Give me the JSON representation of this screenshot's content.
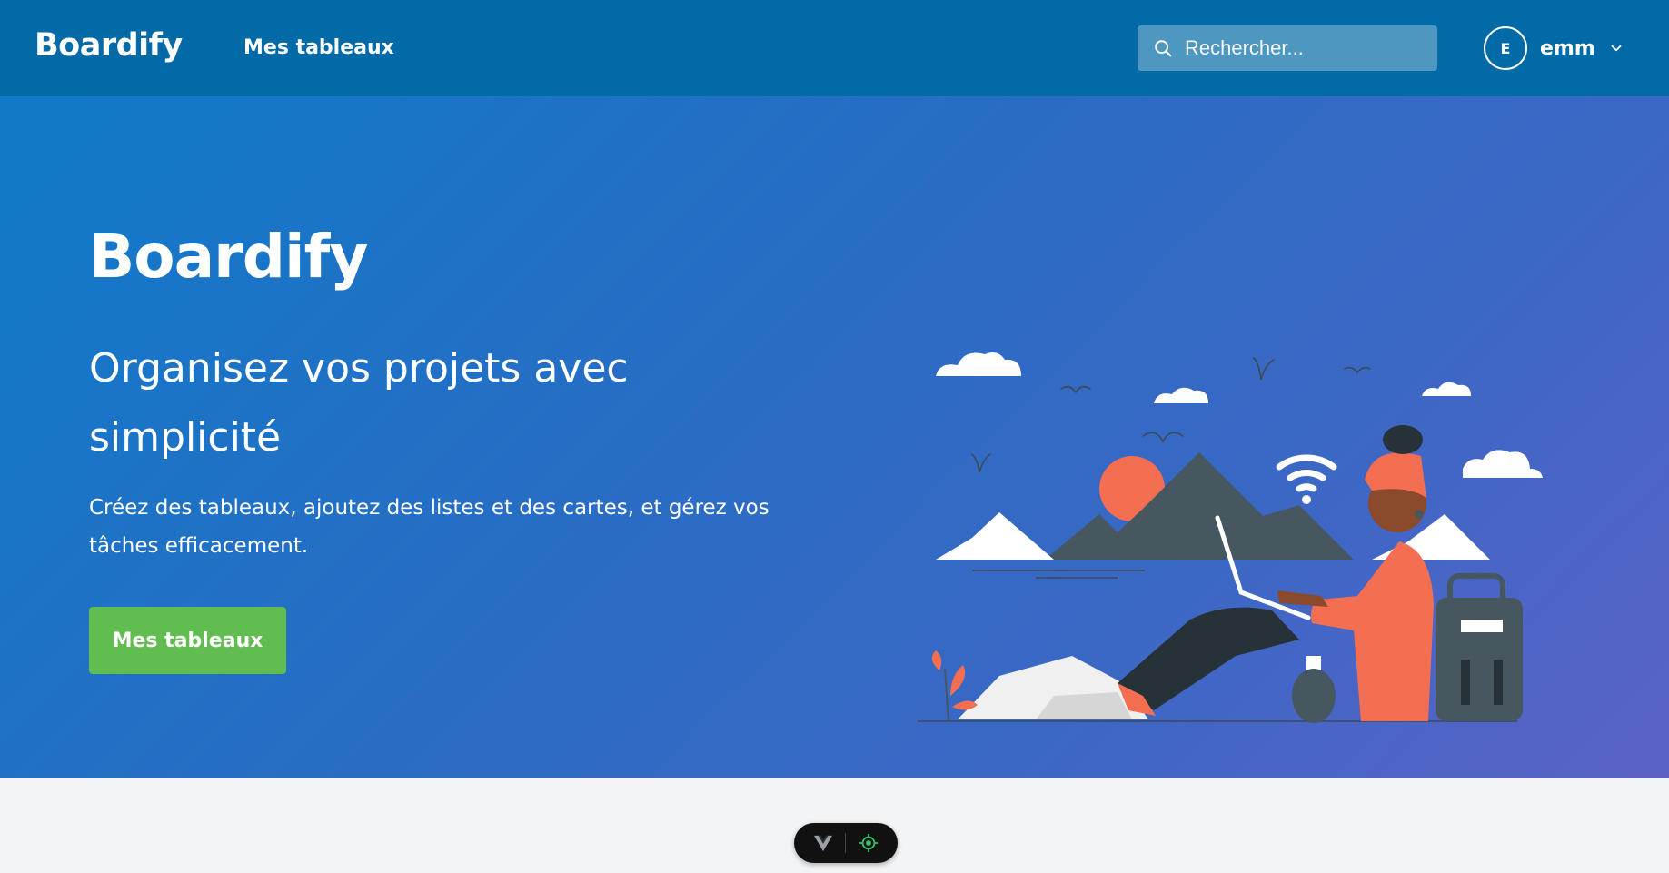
{
  "navbar": {
    "brand": "Boardify",
    "link_label": "Mes tableaux",
    "search_placeholder": "Rechercher...",
    "user": {
      "initial": "E",
      "name": "emm"
    }
  },
  "hero": {
    "title": "Boardify",
    "subtitle": "Organisez vos projets avec simplicité",
    "description": "Créez des tableaux, ajoutez des listes et des cartes, et gérez vos tâches efficacement.",
    "button_label": "Mes tableaux"
  },
  "colors": {
    "navbar": "#026aa7",
    "button": "#61bd4f",
    "accent_illustration": "#f46e52"
  },
  "devtools": {
    "icons": [
      "vue-logo-icon",
      "target-icon"
    ]
  }
}
